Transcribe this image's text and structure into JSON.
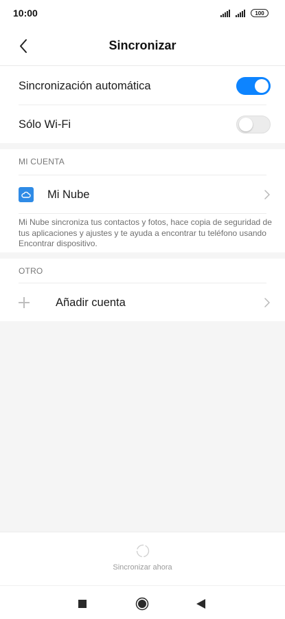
{
  "status_bar": {
    "time": "10:00",
    "battery": "100"
  },
  "header": {
    "title": "Sincronizar",
    "back_icon": "chevron-left-icon"
  },
  "settings": {
    "auto_sync": {
      "label": "Sincronización automática",
      "enabled": true
    },
    "wifi_only": {
      "label": "Sólo Wi-Fi",
      "enabled": false
    }
  },
  "mi_account": {
    "section_title": "MI CUENTA",
    "item_label": "Mi Nube",
    "icon": "cloud-icon",
    "description": "Mi Nube sincroniza tus contactos y fotos, hace copia de seguridad de tus aplicaciones y ajustes y te ayuda a encontrar tu teléfono usando Encontrar dispositivo."
  },
  "other": {
    "section_title": "OTRO",
    "add_account_label": "Añadir cuenta",
    "icon": "plus-icon"
  },
  "sync_now": {
    "label": "Sincronizar ahora",
    "icon": "sync-icon"
  },
  "colors": {
    "accent": "#0d84ff",
    "mi_cloud": "#2f8be6",
    "band": "#f5f5f5"
  }
}
